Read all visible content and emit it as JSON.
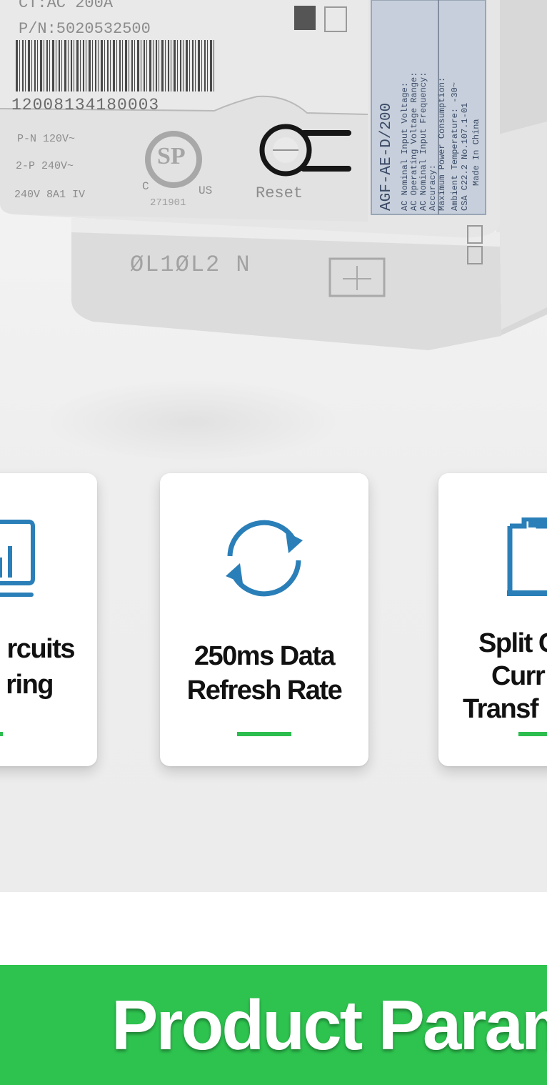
{
  "device": {
    "ct_text": "CT:AC 200A",
    "pn_text": "P/N:5020532500",
    "serial_text": "12008134180003",
    "wiring_lines": [
      "P-N 120V~",
      "2-P 240V~",
      "240V 8A1 IV"
    ],
    "csa_mark": "SP",
    "csa_c": "C",
    "csa_us": "US",
    "csa_number": "271901",
    "reset_label": "Reset",
    "terminal_label": "ØL1ØL2 N",
    "model_label": "AGF-AE-D/200",
    "spec_lines": [
      "AC Nominal Input Voltage:",
      "AC Operating Voltage Range:",
      "AC Nominal Input Frequency:",
      "Accuracy:",
      "Maximum Power Consumption:",
      "Ambient Temperature: -30~",
      "CSA C22.2 No.107.1-01",
      "Made In China"
    ]
  },
  "features": [
    {
      "title_line1": "rcuits",
      "title_line2": "ring",
      "icon": "monitor-chart-icon"
    },
    {
      "title_line1": "250ms Data",
      "title_line2": "Refresh Rate",
      "icon": "refresh-icon"
    },
    {
      "title_line1": "Split C",
      "title_line2": "Curr",
      "title_line3": "Transf",
      "icon": "split-core-ct-icon"
    }
  ],
  "banner": {
    "title": "Product Param"
  },
  "colors": {
    "accent_green": "#2cbd4e",
    "icon_blue": "#2a7fb8",
    "banner_green": "#2ec34f"
  }
}
